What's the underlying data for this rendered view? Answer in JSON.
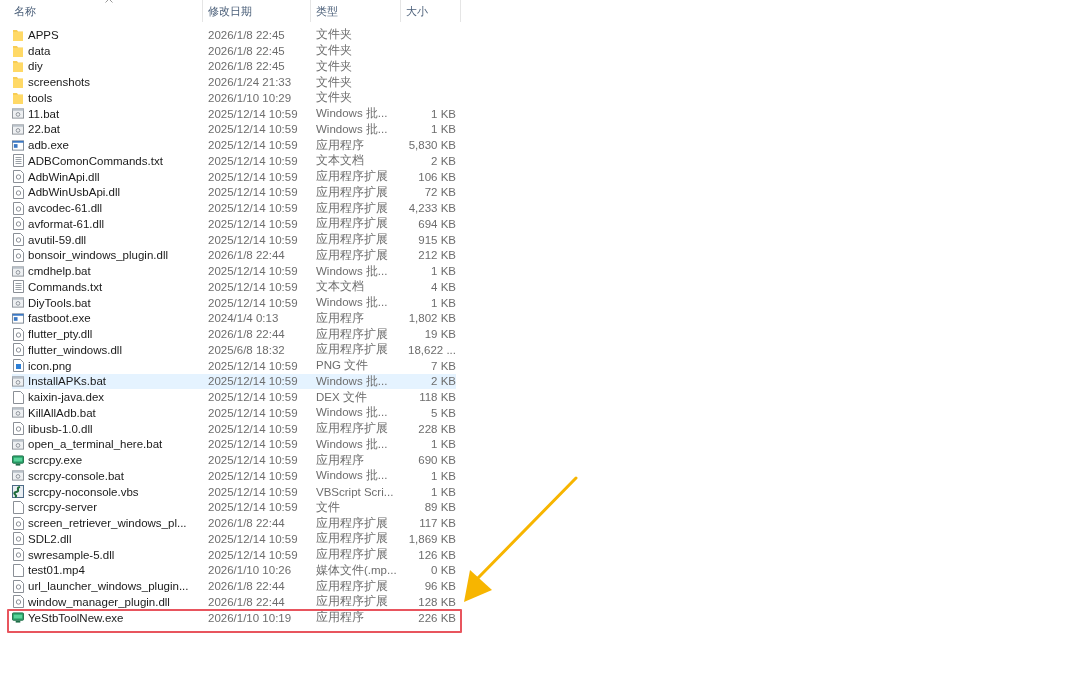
{
  "columns": [
    "名称",
    "修改日期",
    "类型",
    "大小"
  ],
  "rows": [
    {
      "name": "APPS",
      "date": "2026/1/8 22:45",
      "type": "文件夹",
      "size": "",
      "kind": "folder",
      "selected": false,
      "outlined": false
    },
    {
      "name": "data",
      "date": "2026/1/8 22:45",
      "type": "文件夹",
      "size": "",
      "kind": "folder",
      "selected": false,
      "outlined": false
    },
    {
      "name": "diy",
      "date": "2026/1/8 22:45",
      "type": "文件夹",
      "size": "",
      "kind": "folder",
      "selected": false,
      "outlined": false
    },
    {
      "name": "screenshots",
      "date": "2026/1/24 21:33",
      "type": "文件夹",
      "size": "",
      "kind": "folder",
      "selected": false,
      "outlined": false
    },
    {
      "name": "tools",
      "date": "2026/1/10 10:29",
      "type": "文件夹",
      "size": "",
      "kind": "folder",
      "selected": false,
      "outlined": false
    },
    {
      "name": "11.bat",
      "date": "2025/12/14 10:59",
      "type": "Windows 批...",
      "size": "1 KB",
      "kind": "bat",
      "selected": false,
      "outlined": false
    },
    {
      "name": "22.bat",
      "date": "2025/12/14 10:59",
      "type": "Windows 批...",
      "size": "1 KB",
      "kind": "bat",
      "selected": false,
      "outlined": false
    },
    {
      "name": "adb.exe",
      "date": "2025/12/14 10:59",
      "type": "应用程序",
      "size": "5,830 KB",
      "kind": "exe",
      "selected": false,
      "outlined": false
    },
    {
      "name": "ADBComonCommands.txt",
      "date": "2025/12/14 10:59",
      "type": "文本文档",
      "size": "2 KB",
      "kind": "txt",
      "selected": false,
      "outlined": false
    },
    {
      "name": "AdbWinApi.dll",
      "date": "2025/12/14 10:59",
      "type": "应用程序扩展",
      "size": "106 KB",
      "kind": "dll",
      "selected": false,
      "outlined": false
    },
    {
      "name": "AdbWinUsbApi.dll",
      "date": "2025/12/14 10:59",
      "type": "应用程序扩展",
      "size": "72 KB",
      "kind": "dll",
      "selected": false,
      "outlined": false
    },
    {
      "name": "avcodec-61.dll",
      "date": "2025/12/14 10:59",
      "type": "应用程序扩展",
      "size": "4,233 KB",
      "kind": "dll",
      "selected": false,
      "outlined": false
    },
    {
      "name": "avformat-61.dll",
      "date": "2025/12/14 10:59",
      "type": "应用程序扩展",
      "size": "694 KB",
      "kind": "dll",
      "selected": false,
      "outlined": false
    },
    {
      "name": "avutil-59.dll",
      "date": "2025/12/14 10:59",
      "type": "应用程序扩展",
      "size": "915 KB",
      "kind": "dll",
      "selected": false,
      "outlined": false
    },
    {
      "name": "bonsoir_windows_plugin.dll",
      "date": "2026/1/8 22:44",
      "type": "应用程序扩展",
      "size": "212 KB",
      "kind": "dll",
      "selected": false,
      "outlined": false
    },
    {
      "name": "cmdhelp.bat",
      "date": "2025/12/14 10:59",
      "type": "Windows 批...",
      "size": "1 KB",
      "kind": "bat",
      "selected": false,
      "outlined": false
    },
    {
      "name": "Commands.txt",
      "date": "2025/12/14 10:59",
      "type": "文本文档",
      "size": "4 KB",
      "kind": "txt",
      "selected": false,
      "outlined": false
    },
    {
      "name": "DiyTools.bat",
      "date": "2025/12/14 10:59",
      "type": "Windows 批...",
      "size": "1 KB",
      "kind": "bat",
      "selected": false,
      "outlined": false
    },
    {
      "name": "fastboot.exe",
      "date": "2024/1/4 0:13",
      "type": "应用程序",
      "size": "1,802 KB",
      "kind": "exe",
      "selected": false,
      "outlined": false
    },
    {
      "name": "flutter_pty.dll",
      "date": "2026/1/8 22:44",
      "type": "应用程序扩展",
      "size": "19 KB",
      "kind": "dll",
      "selected": false,
      "outlined": false
    },
    {
      "name": "flutter_windows.dll",
      "date": "2025/6/8 18:32",
      "type": "应用程序扩展",
      "size": "18,622 ...",
      "kind": "dll",
      "selected": false,
      "outlined": false
    },
    {
      "name": "icon.png",
      "date": "2025/12/14 10:59",
      "type": "PNG 文件",
      "size": "7 KB",
      "kind": "png",
      "selected": false,
      "outlined": false
    },
    {
      "name": "InstallAPKs.bat",
      "date": "2025/12/14 10:59",
      "type": "Windows 批...",
      "size": "2 KB",
      "kind": "bat",
      "selected": true,
      "outlined": false
    },
    {
      "name": "kaixin-java.dex",
      "date": "2025/12/14 10:59",
      "type": "DEX 文件",
      "size": "118 KB",
      "kind": "blank",
      "selected": false,
      "outlined": false
    },
    {
      "name": "KillAllAdb.bat",
      "date": "2025/12/14 10:59",
      "type": "Windows 批...",
      "size": "5 KB",
      "kind": "bat",
      "selected": false,
      "outlined": false
    },
    {
      "name": "libusb-1.0.dll",
      "date": "2025/12/14 10:59",
      "type": "应用程序扩展",
      "size": "228 KB",
      "kind": "dll",
      "selected": false,
      "outlined": false
    },
    {
      "name": "open_a_terminal_here.bat",
      "date": "2025/12/14 10:59",
      "type": "Windows 批...",
      "size": "1 KB",
      "kind": "bat",
      "selected": false,
      "outlined": false
    },
    {
      "name": "scrcpy.exe",
      "date": "2025/12/14 10:59",
      "type": "应用程序",
      "size": "690 KB",
      "kind": "app",
      "selected": false,
      "outlined": false
    },
    {
      "name": "scrcpy-console.bat",
      "date": "2025/12/14 10:59",
      "type": "Windows 批...",
      "size": "1 KB",
      "kind": "bat",
      "selected": false,
      "outlined": false
    },
    {
      "name": "scrcpy-noconsole.vbs",
      "date": "2025/12/14 10:59",
      "type": "VBScript Scri...",
      "size": "1 KB",
      "kind": "vbs",
      "selected": false,
      "outlined": false
    },
    {
      "name": "scrcpy-server",
      "date": "2025/12/14 10:59",
      "type": "文件",
      "size": "89 KB",
      "kind": "blank",
      "selected": false,
      "outlined": false
    },
    {
      "name": "screen_retriever_windows_pl...",
      "date": "2026/1/8 22:44",
      "type": "应用程序扩展",
      "size": "117 KB",
      "kind": "dll",
      "selected": false,
      "outlined": false
    },
    {
      "name": "SDL2.dll",
      "date": "2025/12/14 10:59",
      "type": "应用程序扩展",
      "size": "1,869 KB",
      "kind": "dll",
      "selected": false,
      "outlined": false
    },
    {
      "name": "swresample-5.dll",
      "date": "2025/12/14 10:59",
      "type": "应用程序扩展",
      "size": "126 KB",
      "kind": "dll",
      "selected": false,
      "outlined": false
    },
    {
      "name": "test01.mp4",
      "date": "2026/1/10 10:26",
      "type": "媒体文件(.mp...",
      "size": "0 KB",
      "kind": "blank",
      "selected": false,
      "outlined": false
    },
    {
      "name": "url_launcher_windows_plugin...",
      "date": "2026/1/8 22:44",
      "type": "应用程序扩展",
      "size": "96 KB",
      "kind": "dll",
      "selected": false,
      "outlined": false
    },
    {
      "name": "window_manager_plugin.dll",
      "date": "2026/1/8 22:44",
      "type": "应用程序扩展",
      "size": "128 KB",
      "kind": "dll",
      "selected": false,
      "outlined": false
    },
    {
      "name": "YeStbToolNew.exe",
      "date": "2026/1/10 10:19",
      "type": "应用程序",
      "size": "226 KB",
      "kind": "app",
      "selected": false,
      "outlined": true
    }
  ]
}
